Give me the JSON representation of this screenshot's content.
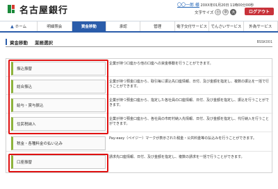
{
  "header": {
    "bank_name": "名古屋銀行",
    "user_name": "〇〇一郎 様",
    "last_login": "20XX年01月20日 11時00分00秒",
    "fontsize_label": "文字サイズ",
    "fontsize_options": [
      "小",
      "中",
      "大"
    ],
    "fontsize_selected": "大",
    "logout_label": "ログアウト"
  },
  "nav": {
    "items": [
      {
        "label": "ホーム",
        "active": false
      },
      {
        "label": "明細照会",
        "active": false
      },
      {
        "label": "資金移動",
        "active": true
      },
      {
        "label": "承認",
        "active": false
      },
      {
        "label": "管理",
        "active": false
      },
      {
        "label": "電子交付サービス",
        "active": false
      },
      {
        "label": "でんさいサービス",
        "active": false
      },
      {
        "label": "外為サービス",
        "active": false
      }
    ]
  },
  "page": {
    "title": "資金移動",
    "subtitle": "業務選択",
    "screen_id": "BSSK001"
  },
  "menu": [
    {
      "label": "振込振替",
      "desc": "企業が持つ口座から他の口座への資金移動を行うことができます。"
    },
    {
      "label": "総合振込",
      "desc": "企業が持つ預金口座から、取引毎に振込先口座情報、日付、及び金額を指定し、複数の振込を一括で行うことができます。"
    },
    {
      "label": "給与・賞与振込",
      "desc": "企業が持つ預金口座から、指定した各社員の口座情報、日付、及び金額を指定し、振込を行うことができます。"
    },
    {
      "label": "住民税納入",
      "desc": "企業が持つ預金口座から、各社員の市町村納入先情報、日付、及び金額を指定し、代行納入を行うことができます。"
    },
    {
      "label": "税金・各種料金の払い込み",
      "desc": "Pay-easy（ペイジー）マークが表示された税金・公共料金等の払込みを行うことができます。"
    },
    {
      "label": "口座振替",
      "desc": "請求先口座情報、日付、及び金額を指定し、複数の請求を一括で行うことができます。"
    }
  ]
}
